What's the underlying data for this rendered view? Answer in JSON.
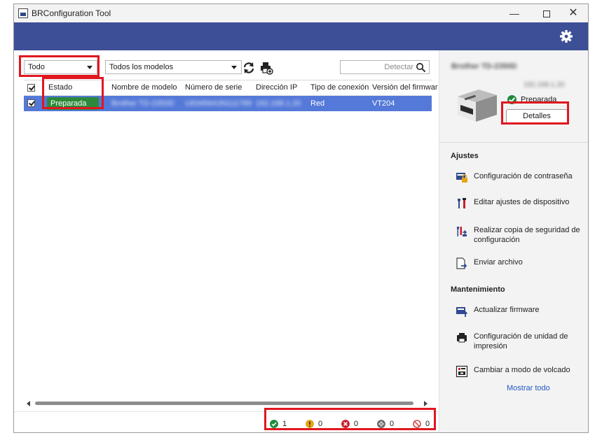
{
  "window": {
    "title": "BRConfiguration Tool",
    "controls": {
      "minimize": "—",
      "maximize": "",
      "close": "✕"
    }
  },
  "toolbar": {
    "filter_status": "Todo",
    "filter_models": "Todos los modelos",
    "search_placeholder": "Detectar"
  },
  "table": {
    "columns": [
      "Estado",
      "Nombre de modelo",
      "Número de serie",
      "Dirección IP",
      "Tipo de conexión",
      "Versión del firmwar"
    ],
    "rows": [
      {
        "status": "Preparada",
        "model": "Brother TD-2350D",
        "serial": "U63456A3N111789",
        "ip": "192.168.1.20",
        "connection": "Red",
        "firmware": "VT204"
      }
    ]
  },
  "statusbar": {
    "ready": "1",
    "warning": "0",
    "error": "0",
    "offline": "0",
    "unsupported": "0"
  },
  "device": {
    "name": "Brother TD-2350D",
    "ip": "192.168.1.20",
    "status": "Preparada",
    "details_label": "Detalles"
  },
  "settings": {
    "title": "Ajustes",
    "items": [
      "Configuración de contraseña",
      "Editar ajustes de dispositivo",
      "Realizar copia de seguridad de configuración",
      "Enviar archivo"
    ]
  },
  "maintenance": {
    "title": "Mantenimiento",
    "items": [
      "Actualizar firmware",
      "Configuración de unidad de impresión",
      "Cambiar a modo de volcado"
    ],
    "show_all": "Mostrar todo"
  },
  "colors": {
    "header": "#3d4f96",
    "selected_row": "#5479d8",
    "ready_green": "#2c8a3a",
    "highlight_red": "#e0161f",
    "link_blue": "#2157c4"
  }
}
